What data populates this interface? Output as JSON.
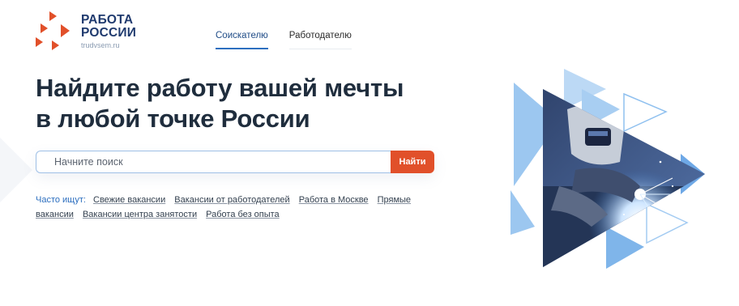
{
  "logo": {
    "line1": "РАБОТА",
    "line2": "РОССИИ",
    "domain": "trudvsem.ru",
    "icon": "logo-arrows-icon"
  },
  "tabs": [
    {
      "label": "Соискателю",
      "active": true
    },
    {
      "label": "Работодателю",
      "active": false
    }
  ],
  "headline": {
    "line1": "Найдите работу вашей мечты",
    "line2": "в любой точке России"
  },
  "search": {
    "placeholder": "Начните поиск",
    "button_label": "Найти"
  },
  "popular": {
    "label": "Часто ищут:",
    "links": [
      "Свежие вакансии",
      "Вакансии от работодателей",
      "Работа в Москве",
      "Прямые вакансии",
      "Вакансии центра занятости",
      "Работа без опыта"
    ]
  },
  "colors": {
    "brand_blue": "#1f3a6e",
    "accent_orange": "#e1502a",
    "link_blue": "#2d6fbf"
  }
}
